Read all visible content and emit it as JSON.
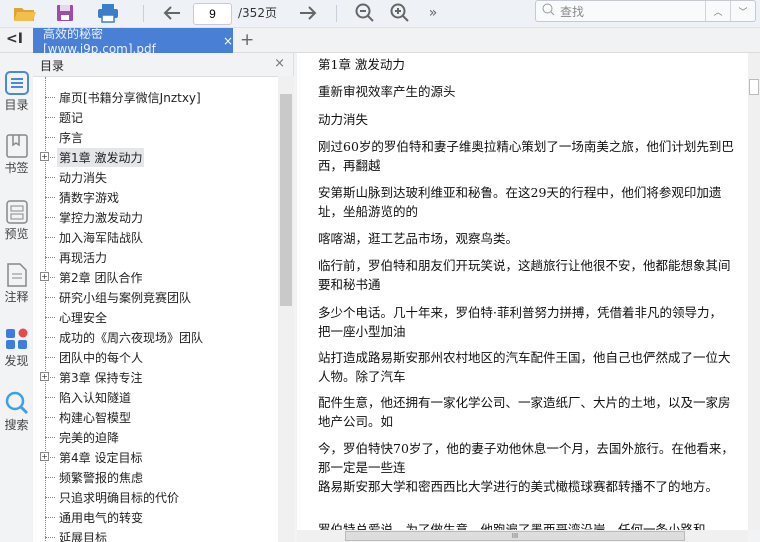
{
  "toolbar": {
    "page_current": "9",
    "page_total": "/352页",
    "search_placeholder": "查找",
    "more": "»"
  },
  "tab": {
    "title": "高效的秘密[www.j9p.com].pdf",
    "close": "×",
    "add": "+",
    "collapse": "<I"
  },
  "rail": [
    {
      "label": "目录",
      "icon": "toc-icon"
    },
    {
      "label": "书签",
      "icon": "bookmark-icon"
    },
    {
      "label": "预览",
      "icon": "preview-icon"
    },
    {
      "label": "注释",
      "icon": "annotation-icon"
    },
    {
      "label": "发现",
      "icon": "discover-icon"
    },
    {
      "label": "搜索",
      "icon": "search-icon"
    }
  ],
  "toc": {
    "title": "目录",
    "close": "×",
    "items": [
      {
        "label": "扉页[书籍分享微信Jnztxy]"
      },
      {
        "label": "题记"
      },
      {
        "label": "序言"
      },
      {
        "label": "第1章 激发动力",
        "expand": true,
        "selected": true
      },
      {
        "label": "动力消失"
      },
      {
        "label": "猜数字游戏"
      },
      {
        "label": "掌控力激发动力"
      },
      {
        "label": "加入海军陆战队"
      },
      {
        "label": "再现活力"
      },
      {
        "label": "第2章 团队合作",
        "expand": true
      },
      {
        "label": "研究小组与案例竞赛团队"
      },
      {
        "label": "心理安全"
      },
      {
        "label": "成功的《周六夜现场》团队"
      },
      {
        "label": "团队中的每个人"
      },
      {
        "label": "第3章 保持专注",
        "expand": true
      },
      {
        "label": "陷入认知隧道"
      },
      {
        "label": "构建心智模型"
      },
      {
        "label": "完美的迫降"
      },
      {
        "label": "第4章 设定目标",
        "expand": true
      },
      {
        "label": "频繁警报的焦虑"
      },
      {
        "label": "只追求明确目标的代价"
      },
      {
        "label": "通用电气的转变"
      },
      {
        "label": "延展目标"
      }
    ]
  },
  "document": {
    "paragraphs": [
      "第1章 激发动力",
      "重新审视效率产生的源头",
      "动力消失",
      "刚过60岁的罗伯特和妻子维奥拉精心策划了一场南美之旅，他们计划先到巴西，再翻越",
      "安第斯山脉到达玻利维亚和秘鲁。在这29天的行程中，他们将参观印加遗址，坐船游览的的",
      "喀喀湖，逛工艺品市场，观察鸟类。",
      "临行前，罗伯特和朋友们开玩笑说，这趟旅行让他很不安，他都能想象其间要和秘书通",
      "多少个电话。几十年来，罗伯特·菲利普努力拼搏，凭借着非凡的领导力，把一座小型加油",
      "站打造成路易斯安那州农村地区的汽车配件王国，他自己也俨然成了一位大人物。除了汽车",
      "配件生意，他还拥有一家化学公司、一家造纸厂、大片的土地，以及一家房地产公司。如",
      "今，罗伯特快70岁了，他的妻子劝他休息一个月，去国外旅行。在他看来，那一定是一些连",
      "路易斯安那大学和密西西比大学进行的美式橄榄球赛都转播不了的地方。",
      "罗伯特总爱说，为了做生意，他跑遍了墨西哥湾沿岸，任何一条小路和"
    ]
  }
}
